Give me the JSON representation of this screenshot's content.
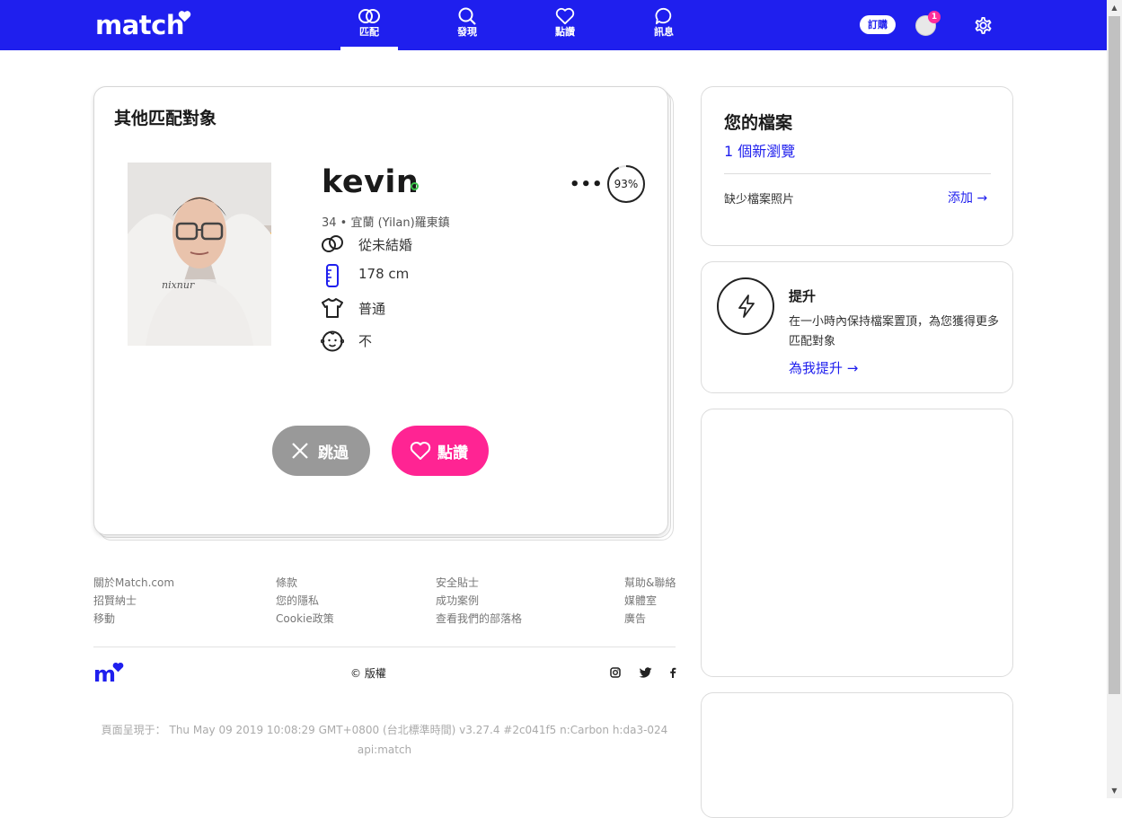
{
  "brand": {
    "logo_text": "match",
    "footer_logo_text": "m",
    "accent": "#1f1fee",
    "like_color": "#ff2493"
  },
  "nav": {
    "items": [
      {
        "label": "匹配",
        "icon": "rings-icon"
      },
      {
        "label": "發現",
        "icon": "search-icon"
      },
      {
        "label": "點讚",
        "icon": "heart-icon"
      },
      {
        "label": "訊息",
        "icon": "chat-bubble-icon"
      }
    ],
    "active": "匹配",
    "subscribe_label": "訂購",
    "notification_count": "1"
  },
  "match_card": {
    "title": "其他匹配對象",
    "name": "kevin",
    "online": true,
    "compatibility": "93%",
    "location": "34 • 宜蘭 (Yilan)羅東鎮",
    "details": [
      {
        "icon": "rings-icon",
        "text": "從未結婚"
      },
      {
        "icon": "ruler-icon",
        "text": "178 cm"
      },
      {
        "icon": "shirt-icon",
        "text": "普通"
      },
      {
        "icon": "baby-face-icon",
        "text": "不"
      }
    ],
    "skip_label": "跳過",
    "like_label": "點讚"
  },
  "footer": {
    "links": [
      [
        "關於Match.com",
        "招賢納士",
        "移動"
      ],
      [
        "條款",
        "您的隱私",
        "Cookie政策"
      ],
      [
        "安全貼士",
        "成功案例",
        "查看我們的部落格"
      ],
      [
        "幫助&聯絡",
        "媒體室",
        "廣告"
      ]
    ],
    "copyright": "© 版權",
    "build_line1": "頁面呈現于： Thu May 09 2019 10:08:29 GMT+0800 (台北標準時間) v3.27.4 #2c041f5 n:Carbon h:da3-024",
    "build_line2": "api:match"
  },
  "profile_panel": {
    "title": "您的檔案",
    "new_views": "1 個新瀏覽",
    "missing": "缺少檔案照片",
    "add_label": "添加 →"
  },
  "boost_panel": {
    "title": "提升",
    "description": "在一小時內保持檔案置頂，為您獲得更多匹配對象",
    "cta": "為我提升 →"
  }
}
